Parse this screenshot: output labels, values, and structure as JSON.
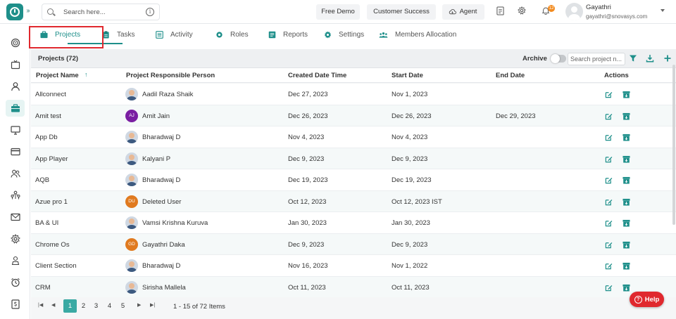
{
  "header": {
    "search_placeholder": "Search here...",
    "info_icon": "i",
    "buttons": [
      "Free Demo",
      "Customer Success",
      "Agent"
    ],
    "notification_count": "12",
    "user": {
      "name": "Gayathri",
      "email": "gayathri@snovasys.com"
    }
  },
  "tabs": [
    "Projects",
    "Tasks",
    "Activity",
    "Roles",
    "Reports",
    "Settings",
    "Members Allocation"
  ],
  "panel": {
    "title": "Projects (72)",
    "archive_label": "Archive",
    "search_placeholder": "Search project n..."
  },
  "table": {
    "columns": [
      "Project Name",
      "Project Responsible Person",
      "Created Date Time",
      "Start Date",
      "End Date",
      "Actions"
    ],
    "rows": [
      {
        "name": "Allconnect",
        "person": "Aadil Raza Shaik",
        "avatar": "photo",
        "initials": "",
        "created": "Dec 27, 2023",
        "start": "Nov 1, 2023",
        "end": ""
      },
      {
        "name": "Amit test",
        "person": "Amit Jain",
        "avatar": "initials",
        "initials": "AJ",
        "created": "Dec 26, 2023",
        "start": "Dec 26, 2023",
        "end": "Dec 29, 2023"
      },
      {
        "name": "App Db",
        "person": "Bharadwaj D",
        "avatar": "photo",
        "initials": "",
        "created": "Nov 4, 2023",
        "start": "Nov 4, 2023",
        "end": ""
      },
      {
        "name": "App Player",
        "person": "Kalyani P",
        "avatar": "photo",
        "initials": "",
        "created": "Dec 9, 2023",
        "start": "Dec 9, 2023",
        "end": ""
      },
      {
        "name": "AQB",
        "person": "Bharadwaj D",
        "avatar": "photo",
        "initials": "",
        "created": "Dec 19, 2023",
        "start": "Dec 19, 2023",
        "end": ""
      },
      {
        "name": "Azue pro 1",
        "person": "Deleted User",
        "avatar": "initials",
        "initials": "DU",
        "created": "Oct 12, 2023",
        "start": "Oct 12, 2023 IST",
        "end": ""
      },
      {
        "name": "BA & UI",
        "person": "Vamsi Krishna Kuruva",
        "avatar": "photo",
        "initials": "",
        "created": "Jan 30, 2023",
        "start": "Jan 30, 2023",
        "end": ""
      },
      {
        "name": "Chrome Os",
        "person": "Gayathri Daka",
        "avatar": "initials",
        "initials": "GD",
        "created": "Dec 9, 2023",
        "start": "Dec 9, 2023",
        "end": ""
      },
      {
        "name": "Client Section",
        "person": "Bharadwaj D",
        "avatar": "photo",
        "initials": "",
        "created": "Nov 16, 2023",
        "start": "Nov 1, 2022",
        "end": ""
      },
      {
        "name": "CRM",
        "person": "Sirisha Mallela",
        "avatar": "photo",
        "initials": "",
        "created": "Oct 11, 2023",
        "start": "Oct 11, 2023",
        "end": ""
      }
    ]
  },
  "pagination": {
    "pages": [
      "1",
      "2",
      "3",
      "4",
      "5"
    ],
    "current": "1",
    "info": "1 - 15 of 72 Items"
  },
  "help_label": "Help",
  "colors": {
    "accent": "#1e8f8a",
    "highlight": "#e0282e",
    "initials_bg": {
      "AJ": "#7a1fa2",
      "DU": "#e07a1f",
      "GD": "#e07a1f"
    }
  }
}
